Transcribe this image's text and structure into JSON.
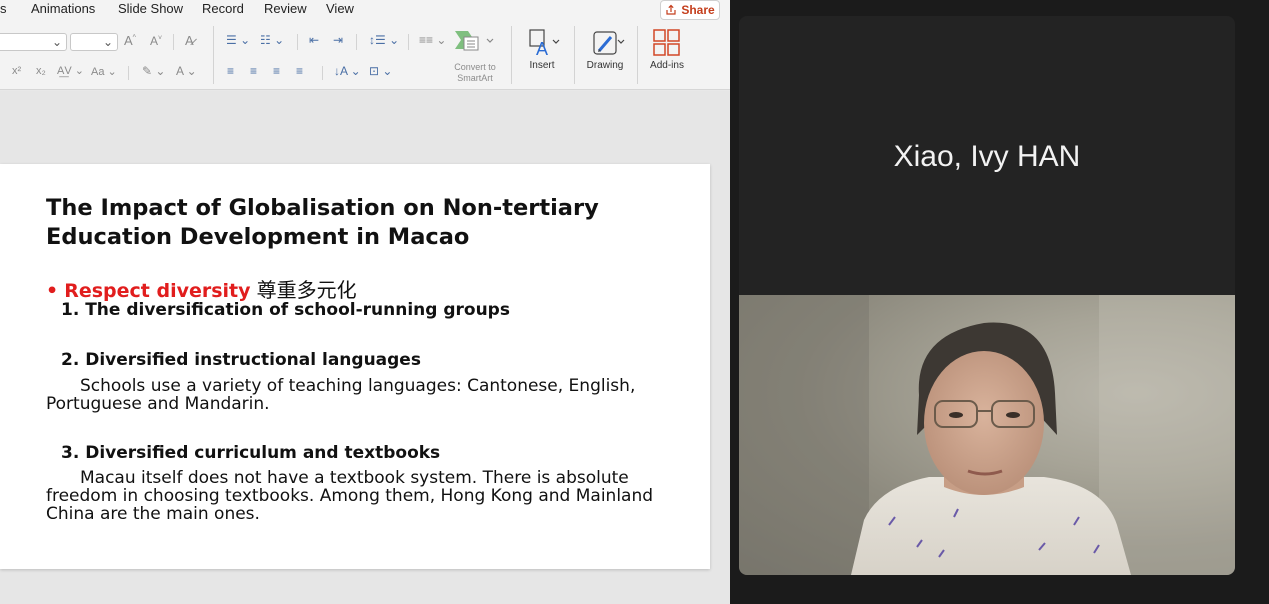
{
  "ribbon_tabs": [
    "s",
    "Animations",
    "Slide Show",
    "Record",
    "Review",
    "View"
  ],
  "share_label": "Share",
  "ribbon": {
    "convert_smartart_label_1": "Convert to",
    "convert_smartart_label_2": "SmartArt",
    "insert_label": "Insert",
    "drawing_label": "Drawing",
    "addins_label": "Add-ins"
  },
  "slide": {
    "title": "The Impact of Globalisation on Non-tertiary Education Development in Macao",
    "bullet_dot": "•",
    "bullet_red": "Respect diversity",
    "bullet_cn": "尊重多元化",
    "item1_heading": "1. The diversification of school-running groups",
    "item2_heading": "2. Diversified instructional languages",
    "item2_body_line1": "Schools use a variety of teaching languages: Cantonese, English,",
    "item2_body_line2": "Portuguese and Mandarin.",
    "item3_heading": "3. Diversified curriculum and textbooks",
    "item3_body_line1": "Macau itself does not have a textbook system. There is absolute",
    "item3_body_line2": "freedom in choosing textbooks. Among them, Hong Kong and Mainland",
    "item3_body_line3": "China are the main ones."
  },
  "video": {
    "participant_name": "Xiao, Ivy HAN"
  },
  "colors": {
    "accent_red": "#e11d1d",
    "share_orange": "#c43e1c"
  }
}
